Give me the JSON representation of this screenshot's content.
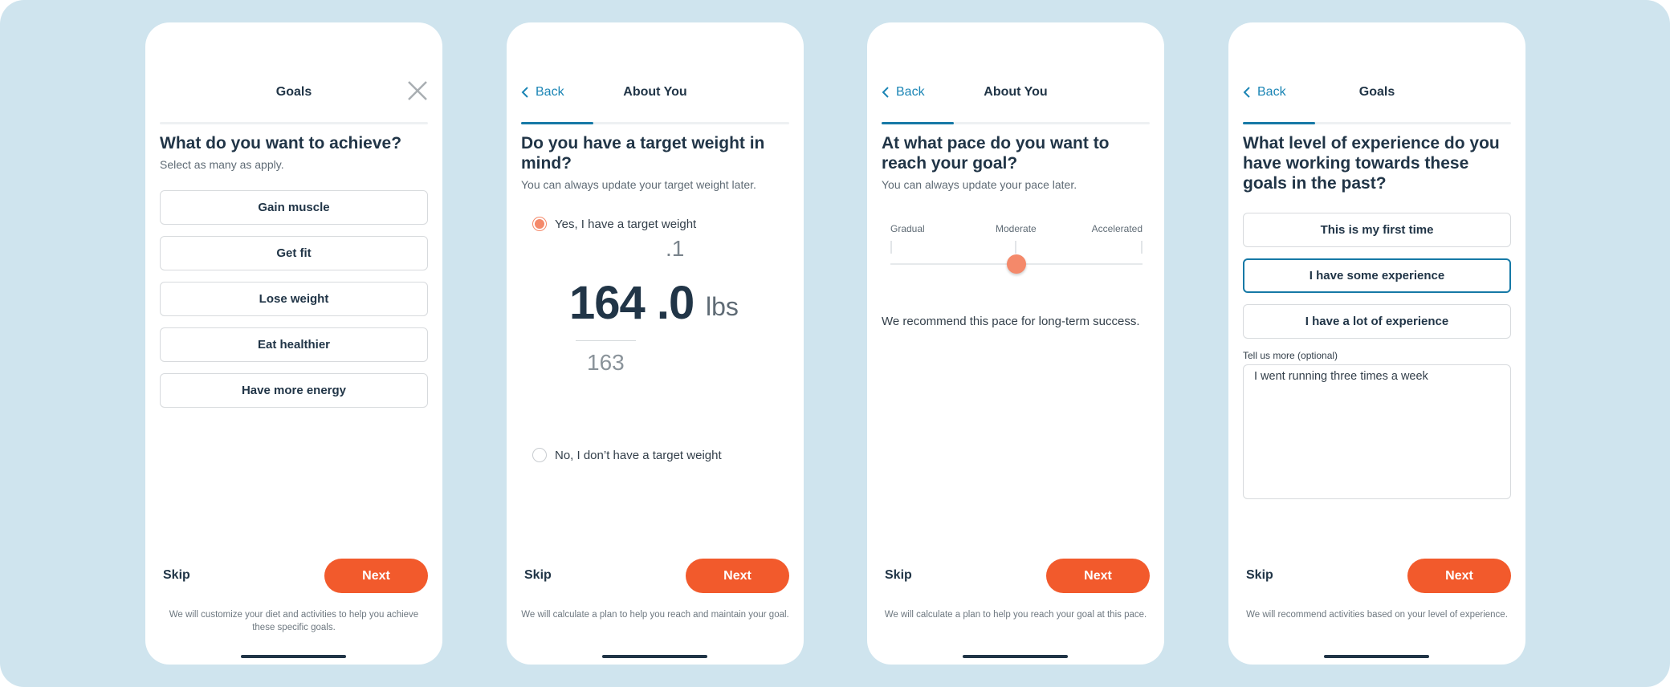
{
  "screens": [
    {
      "header_title": "Goals",
      "question": "What do you want to achieve?",
      "subtitle": "Select as many as apply.",
      "options": [
        "Gain muscle",
        "Get fit",
        "Lose weight",
        "Eat healthier",
        "Have more energy"
      ],
      "skip_label": "Skip",
      "next_label": "Next",
      "footnote": "We will customize your diet and activities to help you achieve these specific goals."
    },
    {
      "back_label": "Back",
      "header_title": "About You",
      "question": "Do you have a target weight in mind?",
      "subtitle": "You can always update your target weight later.",
      "yes_option": "Yes, I have a target weight",
      "no_option": "No, I don’t have a target weight",
      "selected": "yes",
      "picker": {
        "above": ".1",
        "whole": "164",
        "decimal": ".0",
        "unit": "lbs",
        "below": "163"
      },
      "skip_label": "Skip",
      "next_label": "Next",
      "footnote": "We will calculate a plan to help you reach and maintain your goal."
    },
    {
      "back_label": "Back",
      "header_title": "About You",
      "question": "At what pace do you want to reach your goal?",
      "subtitle": "You can always update your pace later.",
      "slider": {
        "labels": [
          "Gradual",
          "Moderate",
          "Accelerated"
        ],
        "selected_index": 1,
        "value": "Moderate"
      },
      "recommendation": "We recommend this pace for long-term success.",
      "skip_label": "Skip",
      "next_label": "Next",
      "footnote": "We will calculate a plan to help you reach your goal at this pace."
    },
    {
      "back_label": "Back",
      "header_title": "Goals",
      "question": "What level of experience do you have working towards these goals in the past?",
      "options": [
        "This is my first time",
        "I have some experience",
        "I have a lot of experience"
      ],
      "selected_option": "I have some experience",
      "textarea_label": "Tell us more (optional)",
      "textarea_value": "I went running three times a week",
      "skip_label": "Skip",
      "next_label": "Next",
      "footnote": "We will recommend activities based on your level of experience."
    }
  ],
  "colors": {
    "accent": "#f25a2c",
    "brand_blue": "#1679a6",
    "radio_orange": "#f4896a",
    "background": "#cfe4ee",
    "text": "#213547"
  }
}
